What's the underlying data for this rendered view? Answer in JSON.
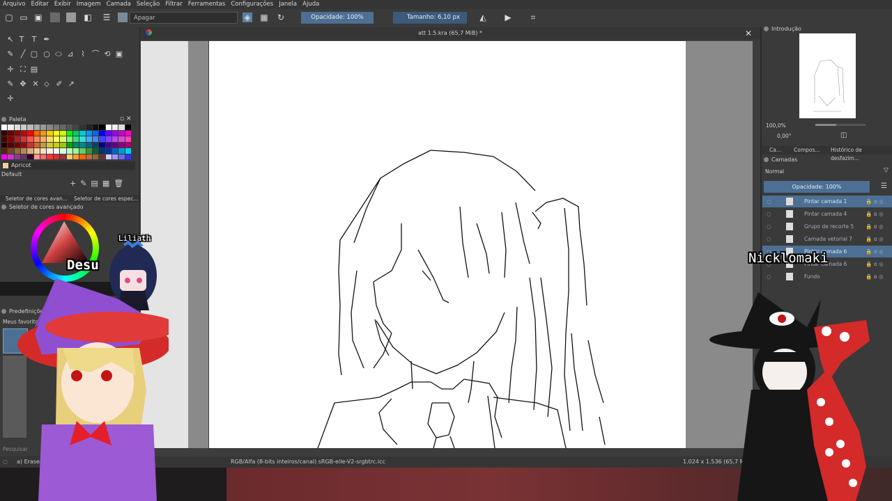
{
  "menu": [
    "Arquivo",
    "Editar",
    "Exibir",
    "Imagem",
    "Camada",
    "Seleção",
    "Filtrar",
    "Ferramentas",
    "Configurações",
    "Janela",
    "Ajuda"
  ],
  "toolbar": {
    "blend_mode": "Apagar",
    "opacity_label": "Opacidade: 100%",
    "size_label": "Tamanho: 6,10 px"
  },
  "document": {
    "title": "att 1.5.kra (65,7 MiB) *"
  },
  "left_dock": {
    "palette_title": "Paleta",
    "color_name": "Apricot",
    "palette_name": "Default",
    "tabs": [
      "Seletor de cores avan...",
      "Seletor de cores espec..."
    ],
    "advanced_selector_title": "Seletor de cores avançado",
    "presets_title": "Predefinições de p...",
    "favorites_label": "Meus favoritos",
    "search_placeholder": "Pesquisar"
  },
  "right_dock": {
    "overview_title": "Introdução",
    "zoom": "100,0%",
    "rotation": "0,00°",
    "tabs": [
      "Ca...",
      "Compos...",
      "Histórico de desfazim..."
    ],
    "layers_title": "Camadas",
    "blend_mode": "Normal",
    "opacity_label": "Opacidade: 100%",
    "layers": [
      {
        "name": "Pintar camada 1",
        "selected": true
      },
      {
        "name": "Pintar camada 4",
        "selected": false
      },
      {
        "name": "Grupo de recorte 5",
        "selected": false
      },
      {
        "name": "Camada vetorial 7",
        "selected": false
      },
      {
        "name": "Pintar camada 6",
        "selected": true
      },
      {
        "name": "Pintar camada 6",
        "selected": false
      },
      {
        "name": "Fundo",
        "selected": false
      }
    ]
  },
  "status": {
    "brush": "a) Eraser",
    "color_profile": "RGB/Alfa (8-bits inteiros/canal)  sRGB-elle-V2-srgbtrc.icc",
    "dimensions": "1.024 x 1.536 (65,7 MiB)"
  },
  "overlay": {
    "avatar_left_name": "Liliath",
    "avatar_left_tag": "Desu",
    "avatar_right_name": "Nicklomaki"
  },
  "colors": {
    "selection": "#4c6f93",
    "panel": "#3a3a3a",
    "apricot": "#f7c9a0"
  }
}
